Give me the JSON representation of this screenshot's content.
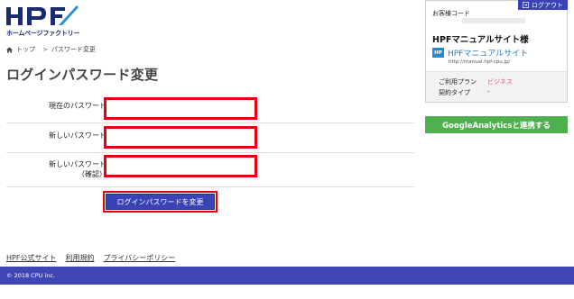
{
  "logo": {
    "mark": "HPF",
    "text": "ホームページファクトリー"
  },
  "breadcrumb": {
    "home": "トップ",
    "separator": ">",
    "current": "パスワード変更"
  },
  "page_title": "ログインパスワード変更",
  "form": {
    "current_password_label": "現在のパスワード",
    "new_password_label": "新しいパスワード",
    "confirm_password_label_line1": "新しいパスワード",
    "confirm_password_label_line2": "（確認）",
    "current_password_value": "",
    "new_password_value": "",
    "confirm_password_value": "",
    "submit_label": "ログインパスワードを変更"
  },
  "footer": {
    "links": [
      "HPF公式サイト",
      "利用規約",
      "プライバシーポリシー"
    ],
    "copyright": "© 2018 CPU inc."
  },
  "panel": {
    "logout_label": "ログアウト",
    "customer_code_label": "お客様コード",
    "company_name": "HPFマニュアルサイト様",
    "site_badge": "HP",
    "site_name": "HPFマニュアルサイト",
    "site_url": "http://manual.hpf-cpu.jp/",
    "plan_label": "ご利用プラン",
    "plan_value": "ビジネス",
    "contract_label": "契約タイプ",
    "contract_value": "-"
  },
  "ga_button_label": "GoogleAnalyticsと連携する",
  "colors": {
    "primary": "#3a43b6",
    "highlight_red": "#e60012",
    "ga_green": "#4fb04f",
    "plan_pink": "#e05a78",
    "logo_navy": "#1c2b6b"
  }
}
